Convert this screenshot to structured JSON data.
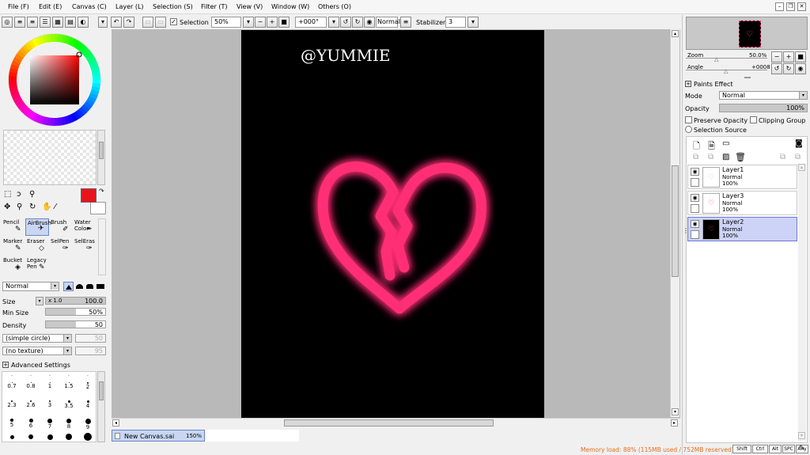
{
  "menu": [
    "File (F)",
    "Edit (E)",
    "Canvas (C)",
    "Layer (L)",
    "Selection (S)",
    "Filter (T)",
    "View (V)",
    "Window (W)",
    "Others (O)"
  ],
  "toolbar": {
    "selection_label": "Selection",
    "zoom_value": "50%",
    "angle_value": "+000°",
    "blend_value": "Normal",
    "stabilizer_label": "Stabilizer",
    "stabilizer_value": "3"
  },
  "canvas": {
    "watermark": "@YUMMIE",
    "tab_name": "New Canvas.sai",
    "tab_zoom": "150%",
    "neon_color": "#ff2f74"
  },
  "colors": {
    "primary": "#e8141c",
    "secondary": "#ffffff"
  },
  "tools": [
    {
      "label": "Pencil",
      "icon": "pencil-icon"
    },
    {
      "label": "AirBrush",
      "icon": "airbrush-icon",
      "selected": true
    },
    {
      "label": "Brush",
      "icon": "brush-icon"
    },
    {
      "label": "Water Color",
      "icon": "watercolor-icon"
    },
    {
      "label": "Marker",
      "icon": "marker-icon"
    },
    {
      "label": "Eraser",
      "icon": "eraser-icon"
    },
    {
      "label": "SelPen",
      "icon": "selpen-icon"
    },
    {
      "label": "SelEras",
      "icon": "seleras-icon"
    },
    {
      "label": "Bucket",
      "icon": "bucket-icon"
    },
    {
      "label": "Legacy Pen",
      "icon": "legacy-pen-icon"
    }
  ],
  "brush": {
    "mode": "Normal",
    "size_label": "Size",
    "size_mult": "x 1.0",
    "size_value": "100.0",
    "minsize_label": "Min Size",
    "minsize_value": "50%",
    "minsize_fraction": 0.5,
    "density_label": "Density",
    "density_value": "50",
    "density_fraction": 0.5,
    "shape": "(simple circle)",
    "shape_value": "50",
    "texture": "(no texture)",
    "texture_value": "95",
    "advanced_label": "Advanced Settings"
  },
  "brush_sizes": [
    "0.7",
    "0.8",
    "1",
    "1.5",
    "2",
    "2.3",
    "2.6",
    "3",
    "3.5",
    "4",
    "5",
    "6",
    "7",
    "8",
    "9"
  ],
  "navigator": {
    "zoom_label": "Zoom",
    "zoom_value": "50.0%",
    "angle_label": "Angle",
    "angle_value": "+0008"
  },
  "paints_effect": {
    "title": "Paints Effect",
    "mode_label": "Mode",
    "mode_value": "Normal",
    "opacity_label": "Opacity",
    "opacity_value": "100%",
    "preserve_opacity": "Preserve Opacity",
    "clipping_group": "Clipping Group",
    "selection_source": "Selection Source"
  },
  "layers": [
    {
      "name": "Layer1",
      "mode": "Normal",
      "opacity": "100%",
      "selected": false
    },
    {
      "name": "Layer3",
      "mode": "Normal",
      "opacity": "100%",
      "selected": false
    },
    {
      "name": "Layer2",
      "mode": "Normal",
      "opacity": "100%",
      "selected": true
    }
  ],
  "status": {
    "memory": "Memory load: 88% (115MB used / 752MB reserved)",
    "keys": [
      "Shift",
      "Ctrl",
      "Alt",
      "SPC",
      "Any"
    ]
  }
}
